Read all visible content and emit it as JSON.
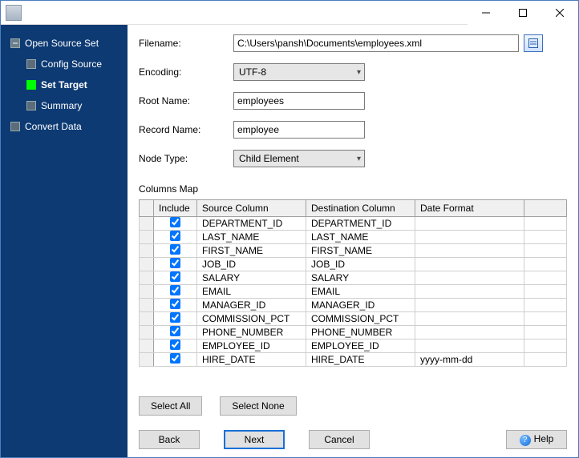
{
  "titlebar": {
    "title": ""
  },
  "sidebar": {
    "root": "Open Source Set",
    "items": [
      {
        "label": "Config Source",
        "active": false
      },
      {
        "label": "Set Target",
        "active": true
      },
      {
        "label": "Summary",
        "active": false
      }
    ],
    "footer": "Convert Data"
  },
  "form": {
    "labels": {
      "filename": "Filename:",
      "encoding": "Encoding:",
      "rootName": "Root Name:",
      "recordName": "Record Name:",
      "nodeType": "Node Type:"
    },
    "values": {
      "filename": "C:\\Users\\pansh\\Documents\\employees.xml",
      "encoding": "UTF-8",
      "rootName": "employees",
      "recordName": "employee",
      "nodeType": "Child Element"
    }
  },
  "columnsMap": {
    "title": "Columns Map",
    "headers": {
      "include": "Include",
      "source": "Source Column",
      "destination": "Destination Column",
      "dateFormat": "Date Format"
    },
    "rows": [
      {
        "include": true,
        "source": "DEPARTMENT_ID",
        "destination": "DEPARTMENT_ID",
        "dateFormat": ""
      },
      {
        "include": true,
        "source": "LAST_NAME",
        "destination": "LAST_NAME",
        "dateFormat": ""
      },
      {
        "include": true,
        "source": "FIRST_NAME",
        "destination": "FIRST_NAME",
        "dateFormat": ""
      },
      {
        "include": true,
        "source": "JOB_ID",
        "destination": "JOB_ID",
        "dateFormat": ""
      },
      {
        "include": true,
        "source": "SALARY",
        "destination": "SALARY",
        "dateFormat": ""
      },
      {
        "include": true,
        "source": "EMAIL",
        "destination": "EMAIL",
        "dateFormat": ""
      },
      {
        "include": true,
        "source": "MANAGER_ID",
        "destination": "MANAGER_ID",
        "dateFormat": ""
      },
      {
        "include": true,
        "source": "COMMISSION_PCT",
        "destination": "COMMISSION_PCT",
        "dateFormat": ""
      },
      {
        "include": true,
        "source": "PHONE_NUMBER",
        "destination": "PHONE_NUMBER",
        "dateFormat": ""
      },
      {
        "include": true,
        "source": "EMPLOYEE_ID",
        "destination": "EMPLOYEE_ID",
        "dateFormat": ""
      },
      {
        "include": true,
        "source": "HIRE_DATE",
        "destination": "HIRE_DATE",
        "dateFormat": "yyyy-mm-dd"
      }
    ]
  },
  "buttons": {
    "selectAll": "Select All",
    "selectNone": "Select None",
    "back": "Back",
    "next": "Next",
    "cancel": "Cancel",
    "help": "Help"
  }
}
